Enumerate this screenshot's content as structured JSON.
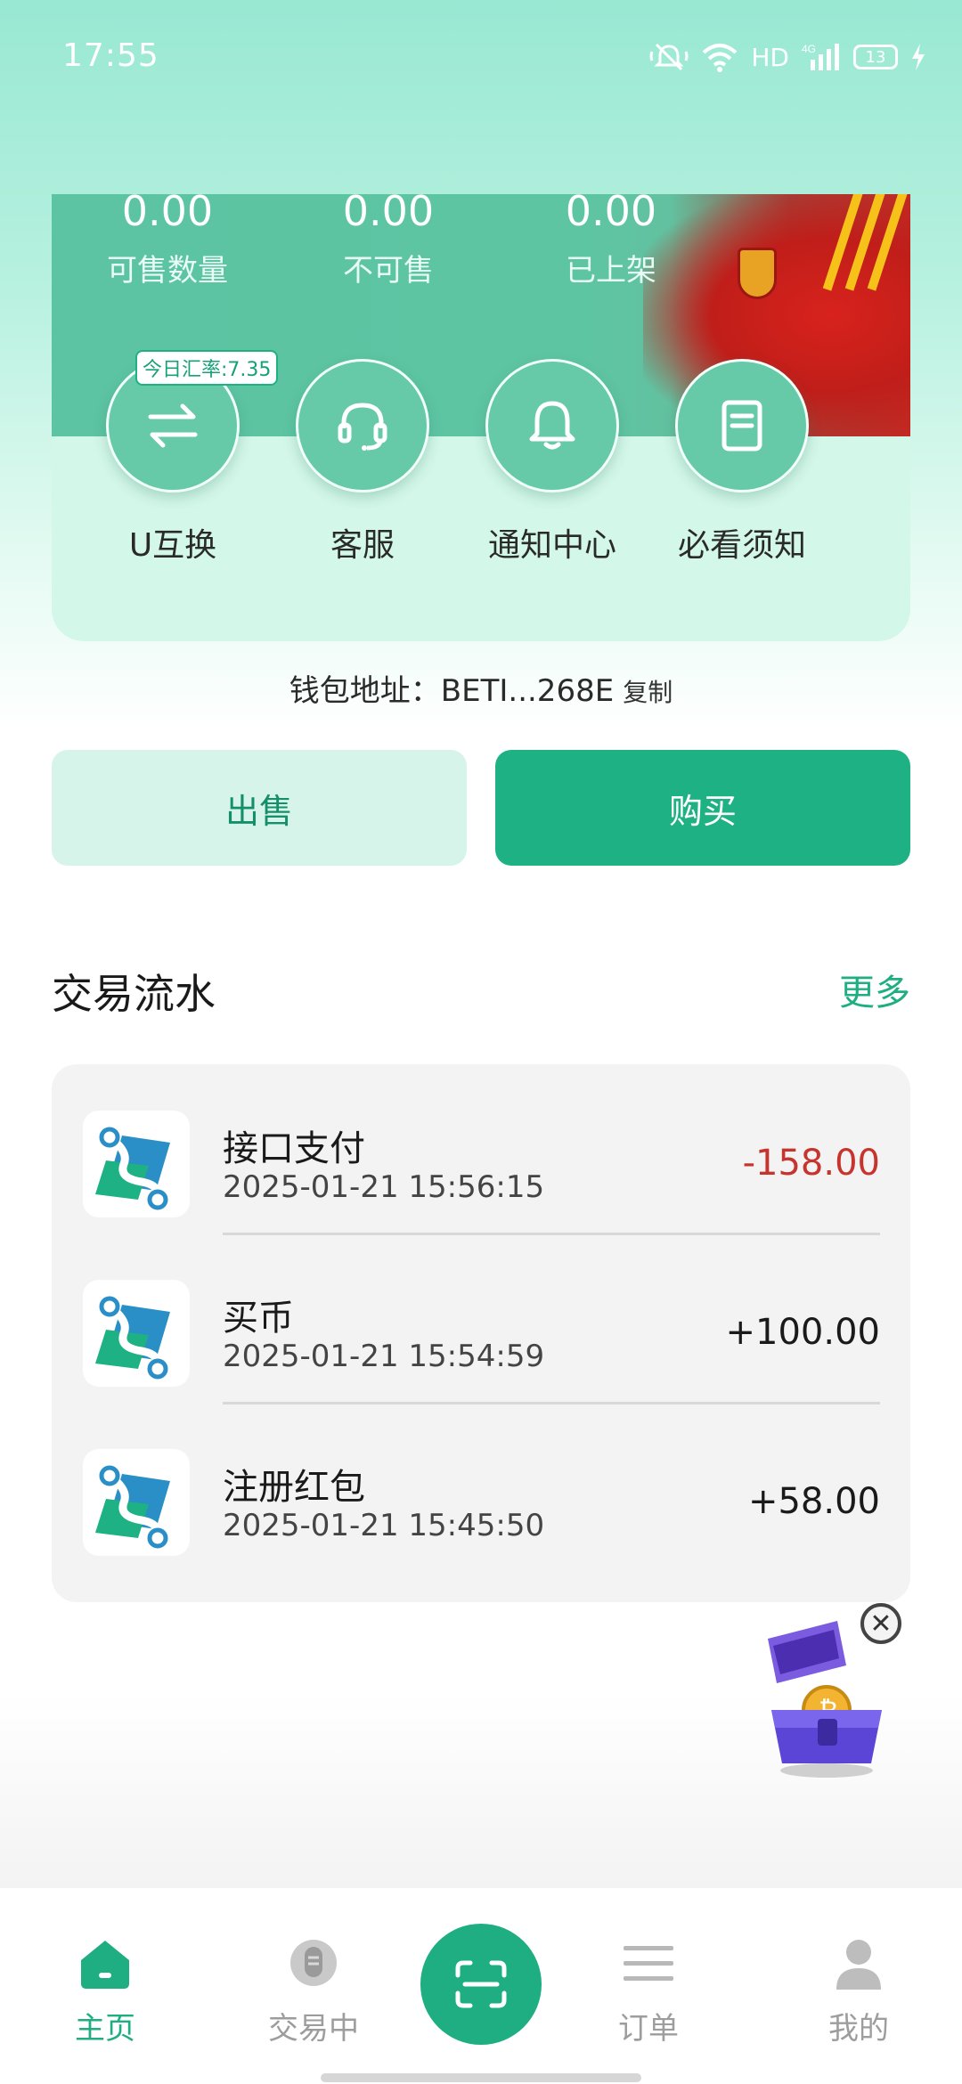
{
  "status_bar": {
    "time": "17:55",
    "network": "HD",
    "signal": "4G",
    "battery": "13"
  },
  "hero": {
    "stats": [
      {
        "value": "0.00",
        "label": "可售数量"
      },
      {
        "value": "0.00",
        "label": "不可售"
      },
      {
        "value": "0.00",
        "label": "已上架"
      }
    ],
    "rate_badge": "今日汇率:7.35",
    "actions": [
      {
        "label": "U互换",
        "icon": "swap-icon"
      },
      {
        "label": "客服",
        "icon": "headset-icon"
      },
      {
        "label": "通知中心",
        "icon": "bell-icon"
      },
      {
        "label": "必看须知",
        "icon": "notebook-icon"
      }
    ]
  },
  "wallet": {
    "label": "钱包地址：BETI...268E",
    "copy": "复制"
  },
  "buttons": {
    "sell": "出售",
    "buy": "购买"
  },
  "transactions": {
    "title": "交易流水",
    "more": "更多",
    "items": [
      {
        "name": "接口支付",
        "time": "2025-01-21 15:56:15",
        "amount": "-158.00"
      },
      {
        "name": "买币",
        "time": "2025-01-21 15:54:59",
        "amount": "+100.00"
      },
      {
        "name": "注册红包",
        "time": "2025-01-21 15:45:50",
        "amount": "+58.00"
      }
    ]
  },
  "tabbar": {
    "items": [
      {
        "label": "主页",
        "icon": "home-icon"
      },
      {
        "label": "交易中",
        "icon": "microphone-icon"
      },
      {
        "label": "订单",
        "icon": "list-icon"
      },
      {
        "label": "我的",
        "icon": "user-icon"
      }
    ],
    "scan_icon": "scan-icon"
  },
  "colors": {
    "accent": "#1eae82",
    "negative": "#c7332d",
    "sell_bg": "#d7f4ea"
  }
}
